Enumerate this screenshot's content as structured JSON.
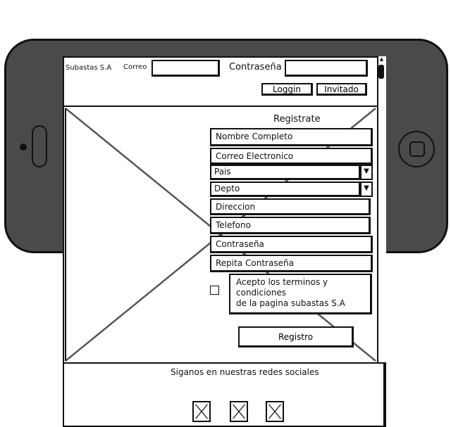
{
  "header": {
    "brand": "Subastas S.A",
    "email_label": "Correo",
    "email_value": "",
    "password_label": "Contraseña",
    "password_value": "",
    "login_label": "Loggin",
    "guest_label": "Invitado"
  },
  "register": {
    "title": "Registrate",
    "fields": {
      "full_name": "Nombre Completo",
      "email": "Correo Electronico",
      "country": "Pais",
      "department": "Depto",
      "address": "Direccion",
      "phone": "Telefono",
      "password": "Contraseña",
      "repeat_password": "Repita Contraseña"
    },
    "terms_text": "Acepto los terminos y\ncondiciones\nde la pagina subastas S.A",
    "submit_label": "Registro"
  },
  "footer": {
    "follow_text": "Siganos en nuestras redes sociales"
  },
  "icons": {
    "scroll_up": "▲",
    "dropdown": "▼"
  }
}
